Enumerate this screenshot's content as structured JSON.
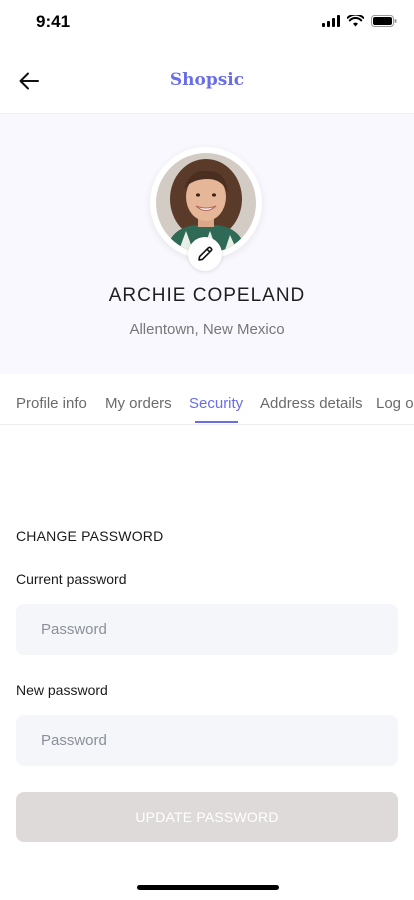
{
  "status_bar": {
    "time": "9:41"
  },
  "header": {
    "title": "Shopsic"
  },
  "profile": {
    "name": "ARCHIE COPELAND",
    "location": "Allentown, New Mexico"
  },
  "tabs": [
    {
      "label": "Profile info",
      "active": false
    },
    {
      "label": "My orders",
      "active": false
    },
    {
      "label": "Security",
      "active": true
    },
    {
      "label": "Address details",
      "active": false
    },
    {
      "label": "Log out",
      "active": false
    }
  ],
  "change_password": {
    "heading": "CHANGE PASSWORD",
    "current_label": "Current password",
    "current_placeholder": "Password",
    "new_label": "New password",
    "new_placeholder": "Password",
    "submit_label": "UPDATE PASSWORD"
  },
  "colors": {
    "accent": "#6a6ee6",
    "hero_bg": "#f9f8fe",
    "input_bg": "#f5f6f9",
    "button_disabled": "#dedad9"
  }
}
